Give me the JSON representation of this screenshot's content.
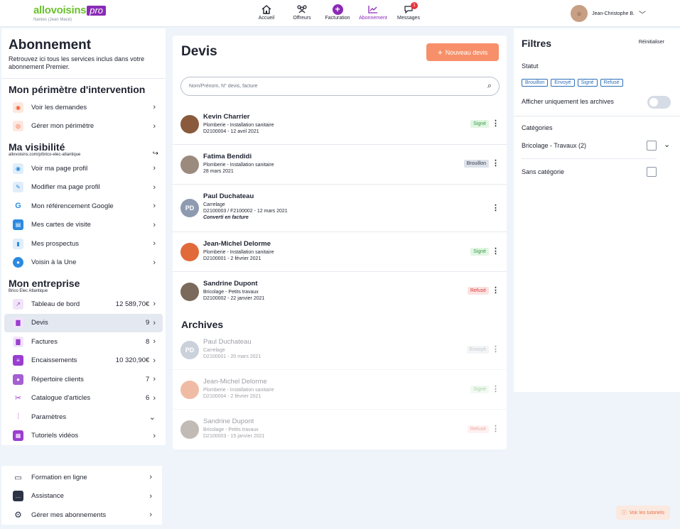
{
  "header": {
    "brand": "allovoisins",
    "brand_pro": "pro",
    "location": "Nantes (Jean Macé)",
    "nav": [
      {
        "label": "Accueil",
        "icon": "home-icon"
      },
      {
        "label": "Offreurs",
        "icon": "people-icon"
      },
      {
        "label": "Facturation",
        "icon": "plus-circle-icon"
      },
      {
        "label": "Abonnement",
        "icon": "chart-icon"
      },
      {
        "label": "Messages",
        "icon": "chat-icon",
        "badge": "1"
      }
    ],
    "user_name": "Jean-Christophe B."
  },
  "sidebar": {
    "title": "Abonnement",
    "subtitle": "Retrouvez ici tous les services inclus dans votre abonnement Premier.",
    "perimetre": {
      "title": "Mon périmètre d'intervention",
      "items": [
        {
          "label": "Voir les demandes",
          "icon": "eye-icon"
        },
        {
          "label": "Gérer mon périmètre",
          "icon": "target-icon"
        }
      ]
    },
    "visibilite": {
      "title": "Ma visibilité",
      "url": "allovoisins.com/p/brico-elec-atlantique",
      "items": [
        {
          "label": "Voir ma page profil",
          "icon": "eye-icon"
        },
        {
          "label": "Modifier ma page profil",
          "icon": "edit-icon"
        },
        {
          "label": "Mon référencement Google",
          "icon": "google-icon"
        },
        {
          "label": "Mes cartes de visite",
          "icon": "card-icon"
        },
        {
          "label": "Mes prospectus",
          "icon": "pages-icon"
        },
        {
          "label": "Voisin à la Une",
          "icon": "user-star-icon"
        }
      ]
    },
    "entreprise": {
      "title": "Mon entreprise",
      "company": "Brico Elec Atlantique",
      "items": [
        {
          "label": "Tableau de bord",
          "value": "12 589,70€",
          "icon": "chart-icon"
        },
        {
          "label": "Devis",
          "value": "9",
          "icon": "doc-icon"
        },
        {
          "label": "Factures",
          "value": "8",
          "icon": "doc-icon"
        },
        {
          "label": "Encaissements",
          "value": "10 320,90€",
          "icon": "coins-icon"
        },
        {
          "label": "Répertoire clients",
          "value": "7",
          "icon": "users-icon"
        },
        {
          "label": "Catalogue d'articles",
          "value": "6",
          "icon": "tools-icon"
        },
        {
          "label": "Paramètres",
          "value": "",
          "icon": "sliders-icon"
        },
        {
          "label": "Tutoriels vidéos",
          "value": "",
          "icon": "film-icon"
        }
      ]
    },
    "bottom": [
      {
        "label": "Formation en ligne",
        "icon": "screen-icon"
      },
      {
        "label": "Assistance",
        "icon": "chat-icon"
      },
      {
        "label": "Gérer mes abonnements",
        "icon": "gear-icon"
      }
    ]
  },
  "devis": {
    "title": "Devis",
    "new_button": "Nouveau devis",
    "search_placeholder": "Nom/Prénom, N° devis, facture",
    "rows": [
      {
        "name": "Kevin Charrier",
        "line1": "Plomberie - Installation sanitaire",
        "line2": "D2100004 - 12 avril 2021",
        "line3": "",
        "status": "Signé",
        "initials": ""
      },
      {
        "name": "Fatima Bendidi",
        "line1": "Plomberie - Installation sanitaire",
        "line2": "28 mars 2021",
        "line3": "",
        "status": "Brouillon",
        "initials": ""
      },
      {
        "name": "Paul Duchateau",
        "line1": "Carrelage",
        "line2": "D2100003 / F2100002 - 12 mars 2021",
        "line3": "Converti en facture",
        "status": "",
        "initials": "PD"
      },
      {
        "name": "Jean-Michel Delorme",
        "line1": "Plomberie - Installation sanitaire",
        "line2": "D2100001 - 2 février 2021",
        "line3": "",
        "status": "Signé",
        "initials": ""
      },
      {
        "name": "Sandrine Dupont",
        "line1": "Bricolage - Petits travaux",
        "line2": "D2100002 - 22 janvier 2021",
        "line3": "",
        "status": "Refusé",
        "initials": ""
      }
    ],
    "archives_title": "Archives",
    "archives": [
      {
        "name": "Paul Duchateau",
        "line1": "Carrelage",
        "line2": "D2100001 - 20 mars 2021",
        "status": "Envoyé",
        "initials": "PD"
      },
      {
        "name": "Jean-Michel Delorme",
        "line1": "Plomberie - Installation sanitaire",
        "line2": "D2100004 - 2 février 2021",
        "status": "Signé",
        "initials": ""
      },
      {
        "name": "Sandrine Dupont",
        "line1": "Bricolage - Petits travaux",
        "line2": "D2100003 - 15 janvier 2021",
        "status": "Refusé",
        "initials": ""
      }
    ]
  },
  "filters": {
    "title": "Filtres",
    "reset": "Réinitialiser",
    "statut_label": "Statut",
    "chips": [
      "Brouillon",
      "Envoyé",
      "Signé",
      "Refusé"
    ],
    "archive_toggle_label": "Afficher uniquement les archives",
    "categories_label": "Catégories",
    "cat1": "Bricolage - Travaux (2)",
    "cat2": "Sans catégorie"
  },
  "tutorial_button": "Voir les tutoriels"
}
